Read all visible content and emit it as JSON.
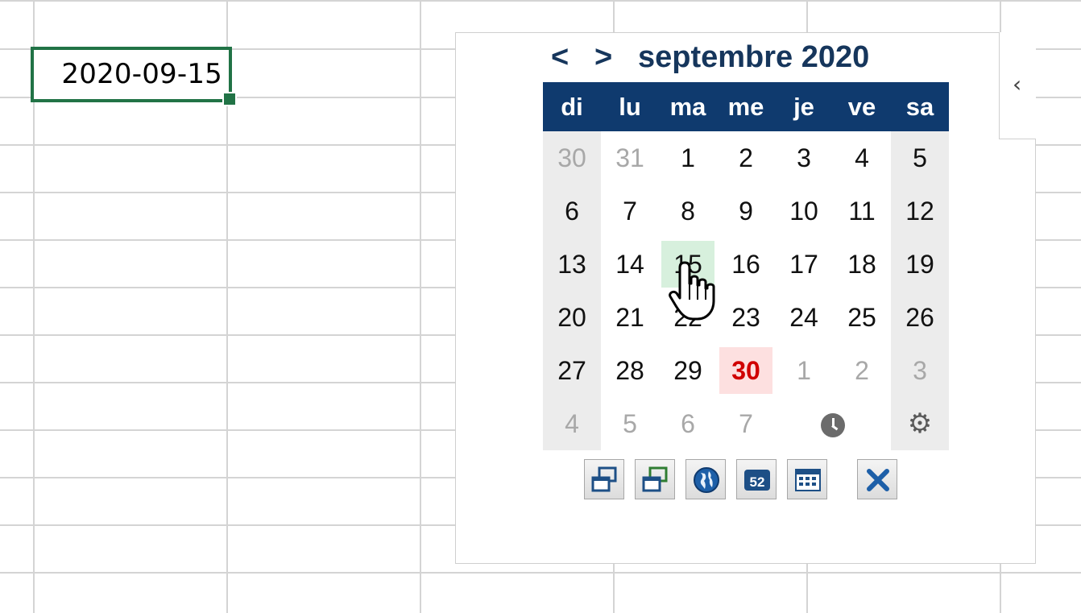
{
  "spreadsheet": {
    "selected_cell_value": "2020-09-15"
  },
  "picker": {
    "prev_label": "<",
    "next_label": ">",
    "month_title": "septembre 2020",
    "weekdays": [
      "di",
      "lu",
      "ma",
      "me",
      "je",
      "ve",
      "sa"
    ],
    "selected_day": "15",
    "today_day": "30",
    "weeks": [
      [
        "30",
        "31",
        "1",
        "2",
        "3",
        "4",
        "5"
      ],
      [
        "6",
        "7",
        "8",
        "9",
        "10",
        "11",
        "12"
      ],
      [
        "13",
        "14",
        "15",
        "16",
        "17",
        "18",
        "19"
      ],
      [
        "20",
        "21",
        "22",
        "23",
        "24",
        "25",
        "26"
      ],
      [
        "27",
        "28",
        "29",
        "30",
        "1",
        "2",
        "3"
      ],
      [
        "4",
        "5",
        "6",
        "7"
      ]
    ],
    "collapse_label": "‹",
    "colors": {
      "header_bg": "#0f3a6e",
      "title": "#16365c",
      "selected_bg": "#d7f0dd",
      "today_bg": "#fde0e0",
      "today_text": "#d00000",
      "cell_border": "#217346"
    },
    "toolbar_icons": [
      "window-icon",
      "window-alt-icon",
      "globe-icon",
      "week-number-icon",
      "calendar-grid-icon",
      "close-icon"
    ],
    "extra_icons": [
      "clock-icon",
      "gear-icon"
    ]
  }
}
